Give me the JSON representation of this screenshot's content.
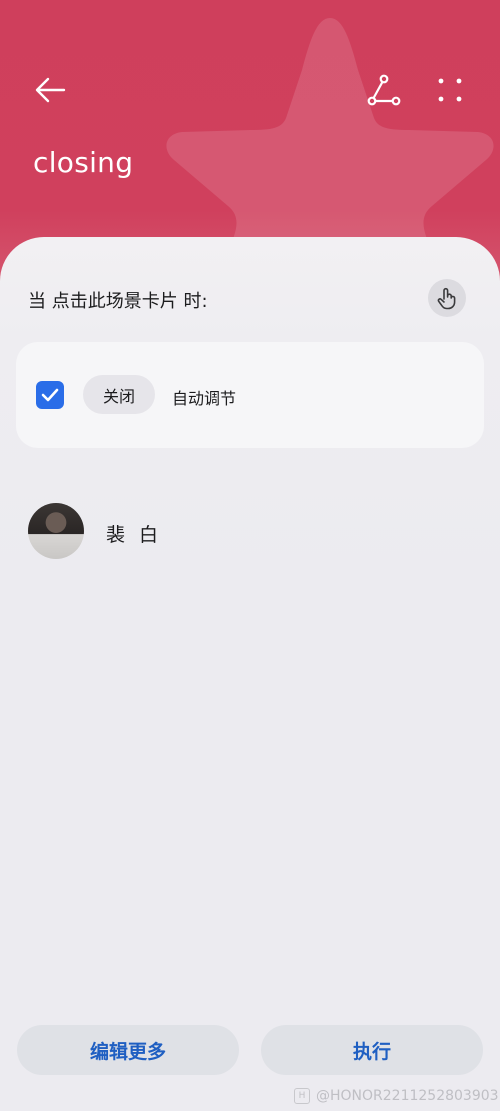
{
  "header": {
    "title": "closing",
    "background_color": "#d0405d",
    "icons": {
      "back": "arrow-left-icon",
      "share": "share-icon",
      "more": "more-dots-icon"
    }
  },
  "trigger": {
    "prompt": "当 点击此场景卡片 时:",
    "icon": "touch-hand-icon"
  },
  "action": {
    "checked": true,
    "chip_label": "关闭",
    "label": "自动调节",
    "accent_color": "#2a6de8"
  },
  "contact": {
    "name": "裴 白"
  },
  "footer": {
    "edit_label": "编辑更多",
    "run_label": "执行",
    "button_text_color": "#1f5fc2"
  },
  "watermark": {
    "badge": "H",
    "text": "@HONOR2211252803903"
  }
}
